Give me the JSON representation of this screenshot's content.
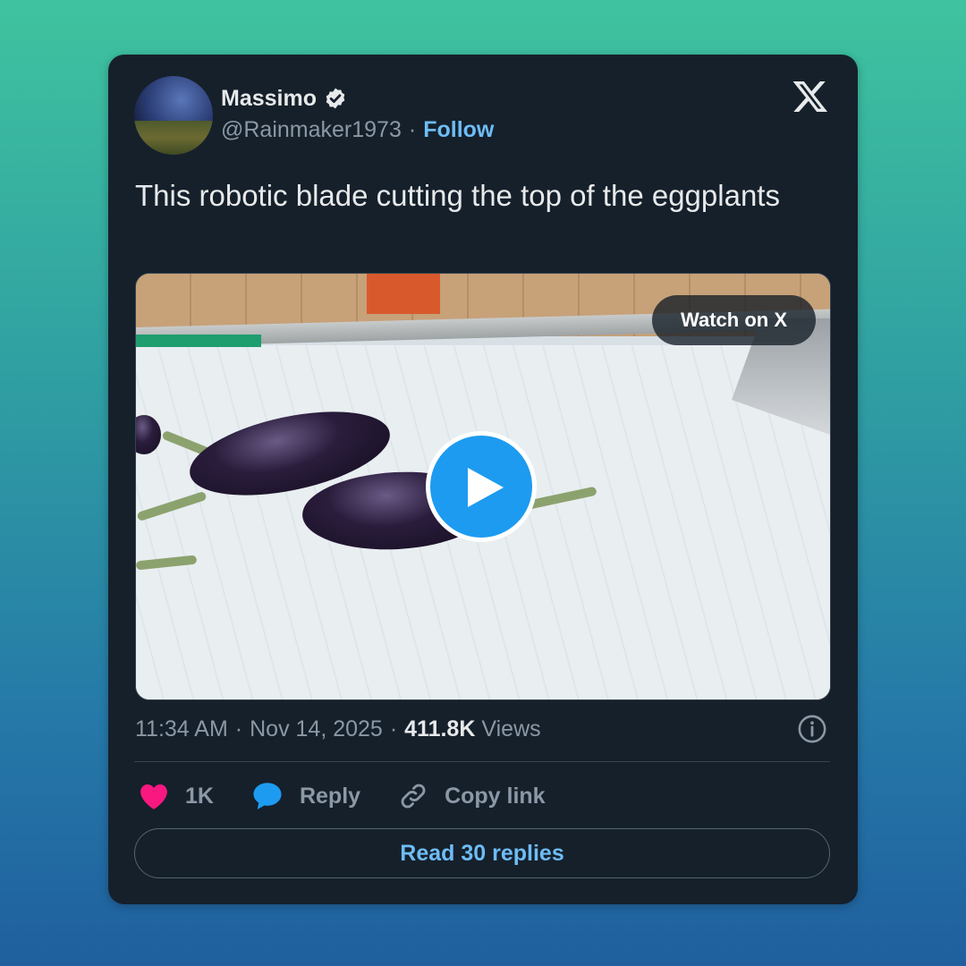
{
  "tweet": {
    "author_name": "Massimo",
    "handle": "@Rainmaker1973",
    "separator": "·",
    "follow_label": "Follow",
    "text": "This robotic blade cutting the top of the eggplants",
    "watch_label": "Watch on X",
    "time": "11:34 AM",
    "date": "Nov 14, 2025",
    "views_count": "411.8K",
    "views_label": "Views",
    "like_count": "1K",
    "reply_label": "Reply",
    "copy_label": "Copy link",
    "read_replies_label": "Read 30 replies"
  },
  "icons": {
    "verified": "verified-badge-icon",
    "logo": "x-logo-icon",
    "play": "play-icon",
    "info": "info-icon",
    "like": "heart-icon",
    "reply": "speech-bubble-icon",
    "copy": "link-icon"
  },
  "colors": {
    "card_bg": "#15202b",
    "accent": "#1d9bf0",
    "link": "#6ebcf5",
    "like": "#f91880",
    "muted": "#8b98a5",
    "text": "#e7e9ea"
  }
}
